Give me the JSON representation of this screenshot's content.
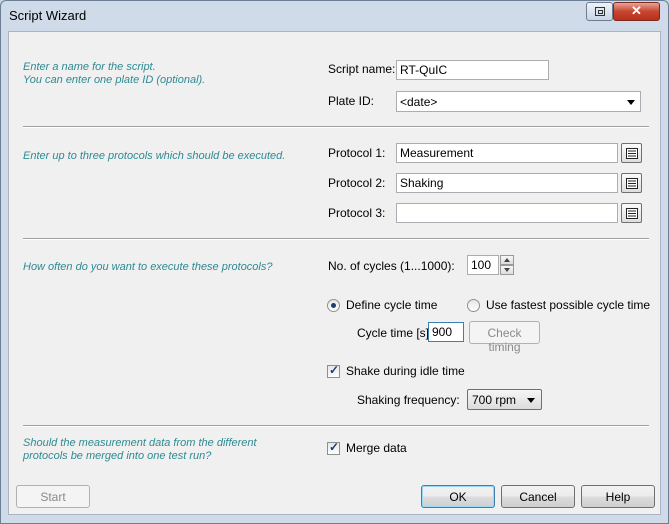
{
  "window": {
    "title": "Script Wizard"
  },
  "section1": {
    "hint_line1": "Enter a name for the script.",
    "hint_line2": "You can enter one plate ID (optional).",
    "script_name_label": "Script name:",
    "script_name_value": "RT-QuIC",
    "plate_id_label": "Plate ID:",
    "plate_id_value": "<date>"
  },
  "section2": {
    "hint": "Enter up to three protocols which should be executed.",
    "protocols": [
      {
        "label": "Protocol 1:",
        "value": "Measurement"
      },
      {
        "label": "Protocol 2:",
        "value": "Shaking"
      },
      {
        "label": "Protocol 3:",
        "value": ""
      }
    ]
  },
  "section3": {
    "hint": "How often do you want to execute these protocols?",
    "cycles_label": "No. of cycles  (1...1000):",
    "cycles_value": "100",
    "radio_define": "Define cycle time",
    "radio_define_selected": true,
    "radio_fastest": "Use fastest possible cycle time",
    "cycle_time_label": "Cycle time [s]:",
    "cycle_time_value": "900",
    "check_timing_label": "Check timing",
    "shake_idle_label": "Shake during idle time",
    "shake_idle_checked": true,
    "shaking_freq_label": "Shaking frequency:",
    "shaking_freq_value": "700 rpm"
  },
  "section4": {
    "hint_line1": "Should the measurement data from the different",
    "hint_line2": "protocols be merged into one test run?",
    "merge_label": "Merge data",
    "merge_checked": true
  },
  "buttons": {
    "start": "Start",
    "ok": "OK",
    "cancel": "Cancel",
    "help": "Help"
  }
}
